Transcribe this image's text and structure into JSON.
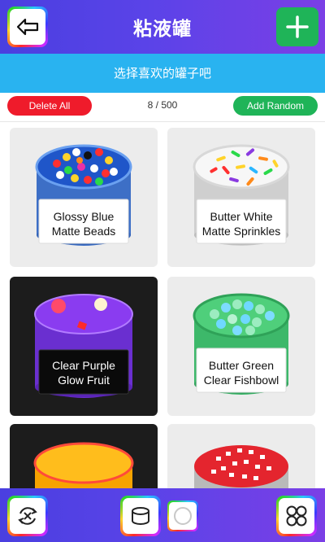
{
  "header": {
    "title": "粘液罐"
  },
  "banner": {
    "text": "选择喜欢的罐子吧"
  },
  "controls": {
    "delete_label": "Delete All",
    "count": "8 / 500",
    "add_random_label": "Add Random"
  },
  "jars": [
    {
      "line1": "Glossy Blue",
      "line2": "Matte Beads"
    },
    {
      "line1": "Butter White",
      "line2": "Matte Sprinkles"
    },
    {
      "line1": "Clear Purple",
      "line2": "Glow Fruit"
    },
    {
      "line1": "Butter Green",
      "line2": "Clear Fishbowl"
    }
  ],
  "icons": {
    "back": "back-arrow-icon",
    "add": "plus-icon",
    "shuffle": "shuffle-icon",
    "jar": "jar-icon",
    "circle": "circle-icon",
    "grid": "grid-icon"
  },
  "colors": {
    "header_bg": "#4a3fe0",
    "banner_bg": "#29b3f0",
    "delete": "#ef1b2b",
    "add": "#1fb458"
  }
}
